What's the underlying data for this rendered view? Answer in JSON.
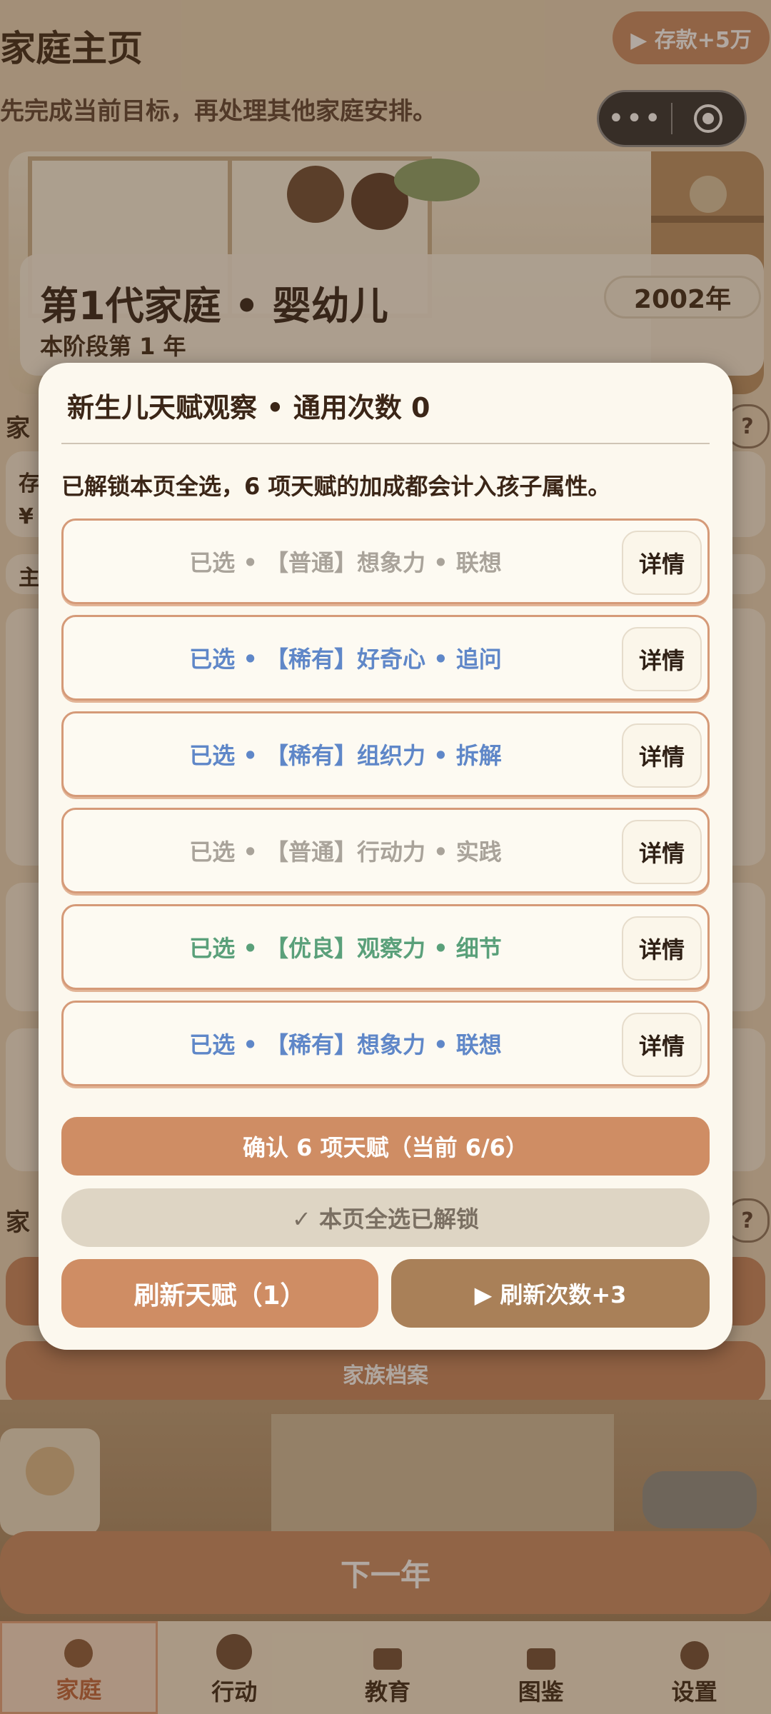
{
  "header": {
    "title": "家庭主页",
    "ad_button": "▶ 存款+5万",
    "subtitle": "先完成当前目标，再处理其他家庭安排。",
    "capsule": {
      "more": "•••"
    }
  },
  "family_card": {
    "title": "第1代家庭 • 婴幼儿",
    "year_badge": "2002年",
    "stage_note": "本阶段第 1 年"
  },
  "background": {
    "section_1_label": "家",
    "fragment_1": "存",
    "fragment_2": "¥",
    "fragment_3": "主",
    "fragment_4": "家",
    "help_glyph": "?",
    "archive_button": "家族档案",
    "next_year_button": "下一年"
  },
  "tabs": [
    {
      "label": "家庭",
      "active": true
    },
    {
      "label": "行动",
      "active": false
    },
    {
      "label": "教育",
      "active": false
    },
    {
      "label": "图鉴",
      "active": false
    },
    {
      "label": "设置",
      "active": false
    }
  ],
  "modal": {
    "title": "新生儿天赋观察 • 通用次数 0",
    "description": "已解锁本页全选，6 项天赋的加成都会计入孩子属性。",
    "options": [
      {
        "text": "已选 •  【普通】想象力 • 联想",
        "rarity": "普通",
        "color": "#a9a39a",
        "detail": "详情"
      },
      {
        "text": "已选 •  【稀有】好奇心 • 追问",
        "rarity": "稀有",
        "color": "#5f87c8",
        "detail": "详情"
      },
      {
        "text": "已选 •  【稀有】组织力 • 拆解",
        "rarity": "稀有",
        "color": "#5f87c8",
        "detail": "详情"
      },
      {
        "text": "已选 •  【普通】行动力 • 实践",
        "rarity": "普通",
        "color": "#a9a39a",
        "detail": "详情"
      },
      {
        "text": "已选 •  【优良】观察力 • 细节",
        "rarity": "优良",
        "color": "#5aa07a",
        "detail": "详情"
      },
      {
        "text": "已选 •  【稀有】想象力 • 联想",
        "rarity": "稀有",
        "color": "#5f87c8",
        "detail": "详情"
      }
    ],
    "confirm_button": "确认 6 项天赋（当前 6/6）",
    "unlocked_button": "✓ 本页全选已解锁",
    "refresh_button": "刷新天赋（1）",
    "ad_refresh_button": "▶ 刷新次数+3"
  },
  "colors": {
    "accent": "#cf8d64",
    "ad_brown": "#a98058",
    "modal_bg": "#fcf8ee",
    "common": "#a9a39a",
    "rare": "#5f87c8",
    "good": "#5aa07a"
  }
}
